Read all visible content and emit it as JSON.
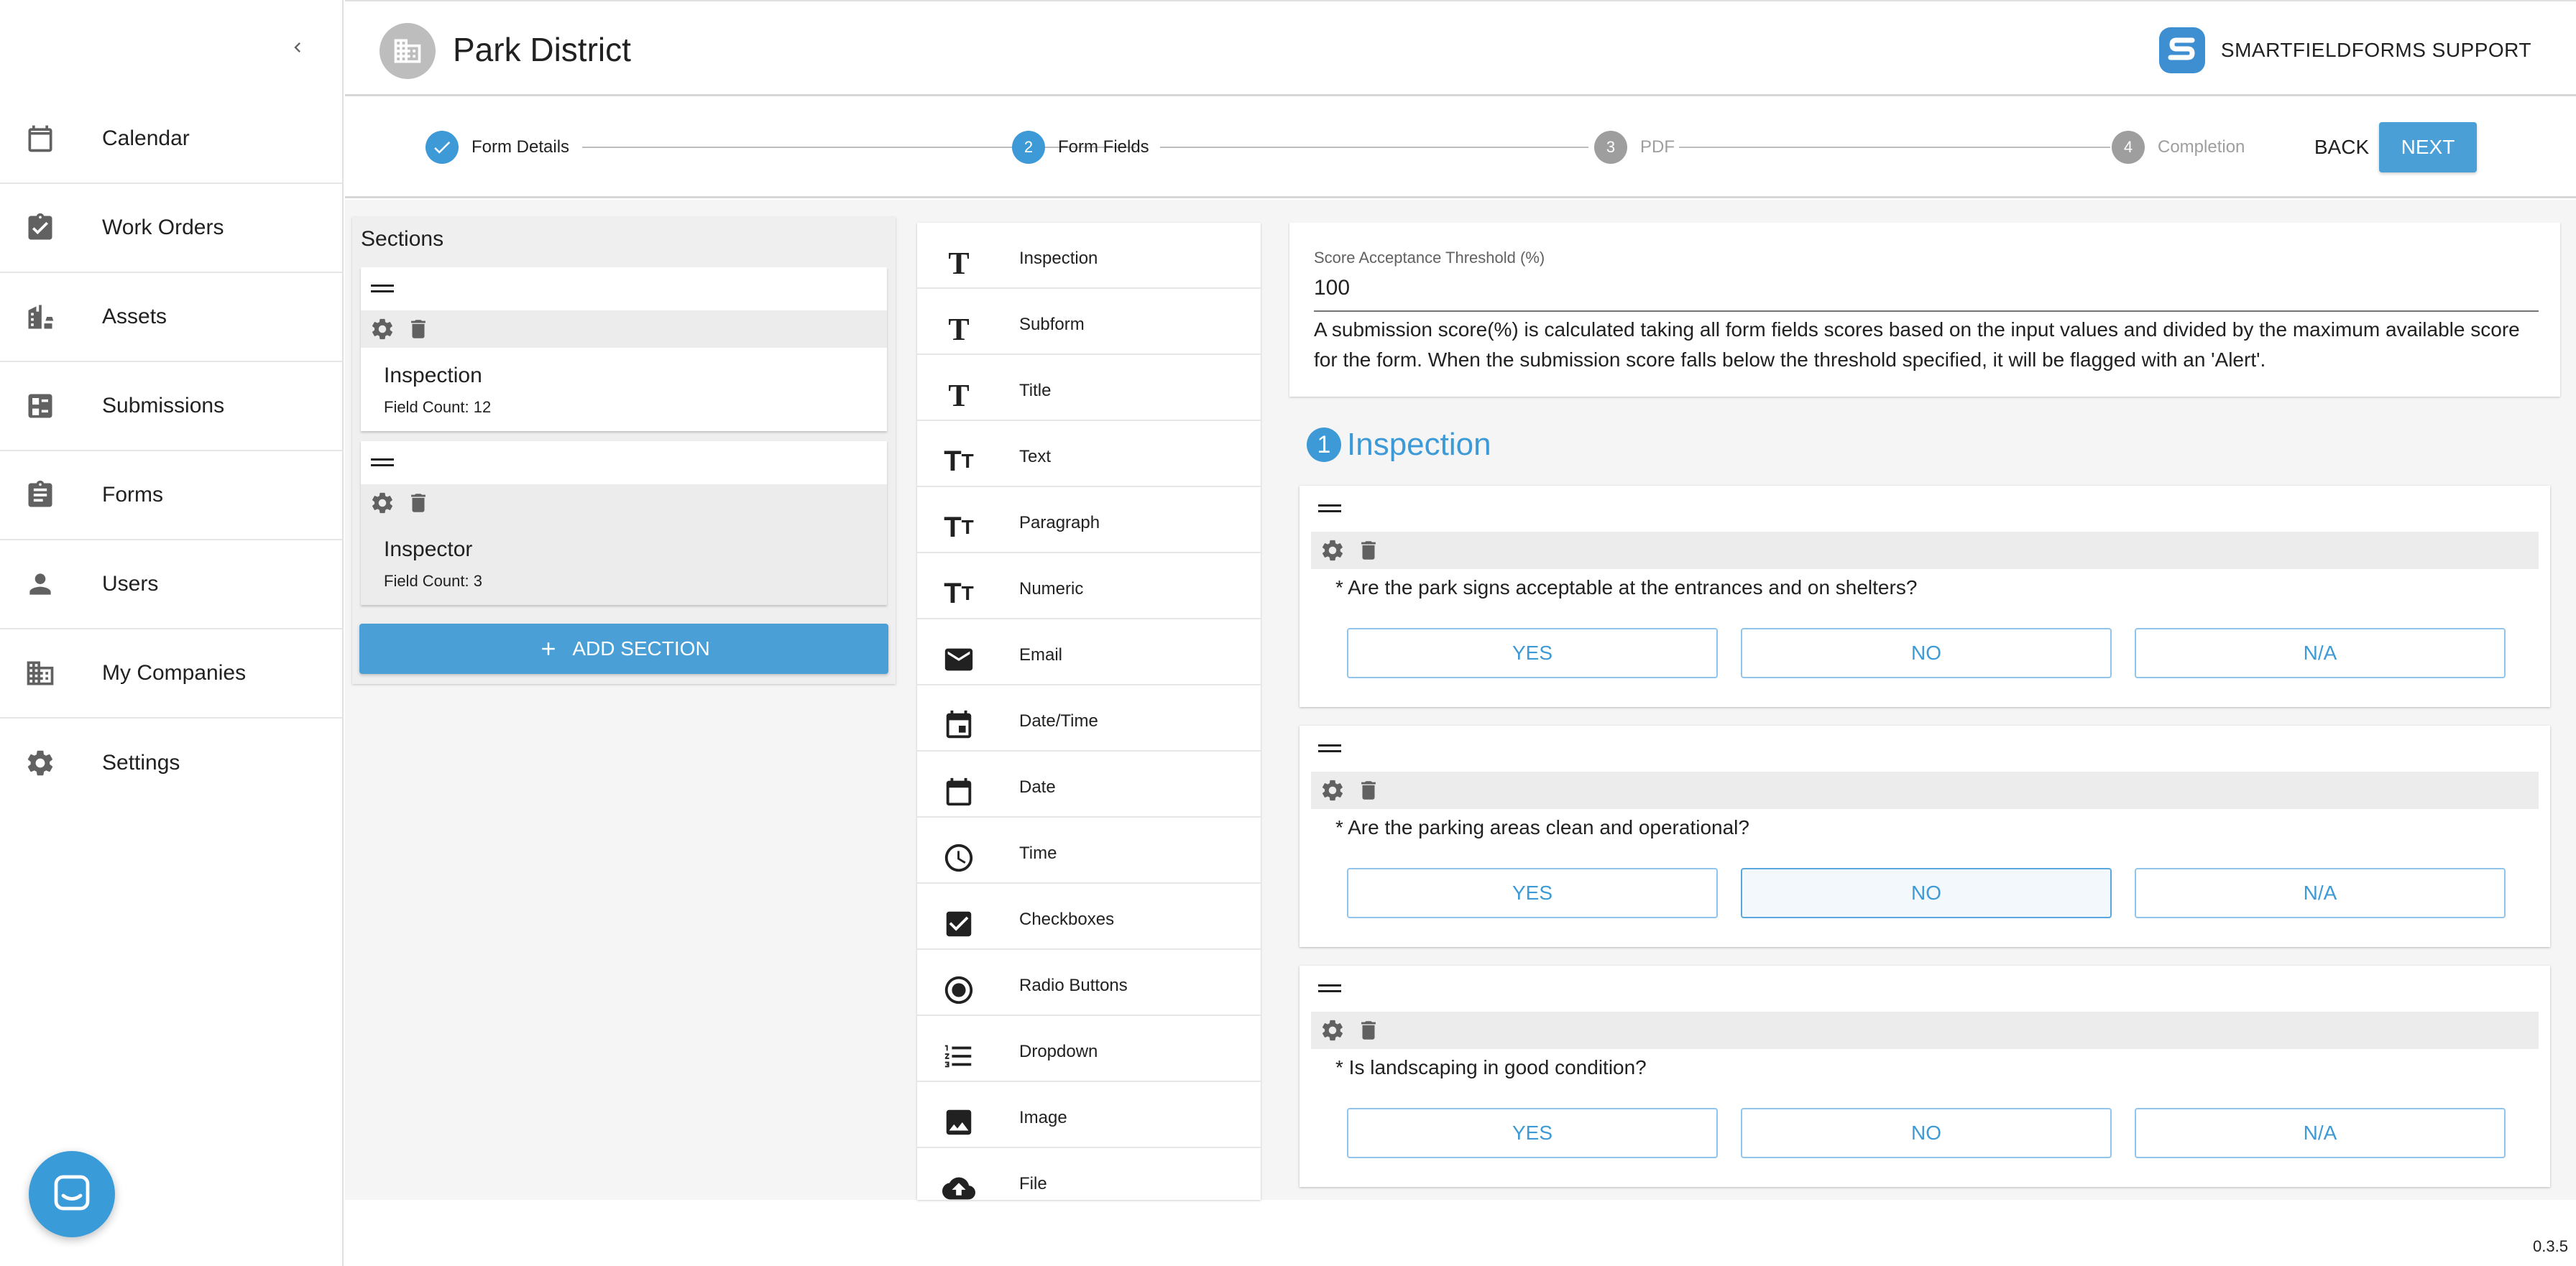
{
  "sidebar": {
    "items": [
      {
        "label": "Calendar",
        "icon": "calendar-icon"
      },
      {
        "label": "Work Orders",
        "icon": "clipboard-icon"
      },
      {
        "label": "Assets",
        "icon": "assets-icon"
      },
      {
        "label": "Submissions",
        "icon": "submissions-icon"
      },
      {
        "label": "Forms",
        "icon": "forms-icon"
      },
      {
        "label": "Users",
        "icon": "user-icon"
      },
      {
        "label": "My Companies",
        "icon": "building-icon"
      },
      {
        "label": "Settings",
        "icon": "gear-icon"
      }
    ]
  },
  "header": {
    "company": "Park District",
    "brand": "SMARTFIELDFORMS SUPPORT"
  },
  "stepper": {
    "steps": [
      {
        "num": "1",
        "label": "Form Details",
        "state": "done"
      },
      {
        "num": "2",
        "label": "Form Fields",
        "state": "active"
      },
      {
        "num": "3",
        "label": "PDF",
        "state": "pending"
      },
      {
        "num": "4",
        "label": "Completion",
        "state": "pending"
      }
    ],
    "back_label": "BACK",
    "next_label": "NEXT"
  },
  "sections_panel": {
    "title": "Sections",
    "sections": [
      {
        "name": "Inspection",
        "count": "Field Count: 12"
      },
      {
        "name": "Inspector",
        "count": "Field Count: 3"
      }
    ],
    "add_label": "ADD SECTION"
  },
  "palette": {
    "items": [
      {
        "label": "Inspection",
        "icon": "text-t-icon"
      },
      {
        "label": "Subform",
        "icon": "text-t-icon"
      },
      {
        "label": "Title",
        "icon": "text-t-icon"
      },
      {
        "label": "Text",
        "icon": "text-size-icon"
      },
      {
        "label": "Paragraph",
        "icon": "text-size-icon"
      },
      {
        "label": "Numeric",
        "icon": "text-size-icon"
      },
      {
        "label": "Email",
        "icon": "email-icon"
      },
      {
        "label": "Date/Time",
        "icon": "event-icon"
      },
      {
        "label": "Date",
        "icon": "calendar-icon"
      },
      {
        "label": "Time",
        "icon": "clock-icon"
      },
      {
        "label": "Checkboxes",
        "icon": "checkbox-icon"
      },
      {
        "label": "Radio Buttons",
        "icon": "radio-icon"
      },
      {
        "label": "Dropdown",
        "icon": "list-icon"
      },
      {
        "label": "Image",
        "icon": "image-icon"
      },
      {
        "label": "File",
        "icon": "upload-icon"
      }
    ]
  },
  "editor": {
    "threshold_label": "Score Acceptance Threshold (%)",
    "threshold_value": "100",
    "threshold_help": "A submission score(%) is calculated taking all form fields scores based on the input values and divided by the maximum available score for the form. When the submission score falls below the threshold specified, it will be flagged with an 'Alert'.",
    "section_number": "1",
    "section_title": "Inspection",
    "questions": [
      {
        "text": "* Are the park signs acceptable at the entrances and on shelters?",
        "options": [
          "YES",
          "NO",
          "N/A"
        ]
      },
      {
        "text": "* Are the parking areas clean and operational?",
        "options": [
          "YES",
          "NO",
          "N/A"
        ]
      },
      {
        "text": "* Is landscaping in good condition?",
        "options": [
          "YES",
          "NO",
          "N/A"
        ]
      }
    ]
  },
  "version": "0.3.5",
  "colors": {
    "accent": "#4a9fd6",
    "accent_text": "#3d9ad6",
    "step_pending": "#9e9e9e"
  }
}
